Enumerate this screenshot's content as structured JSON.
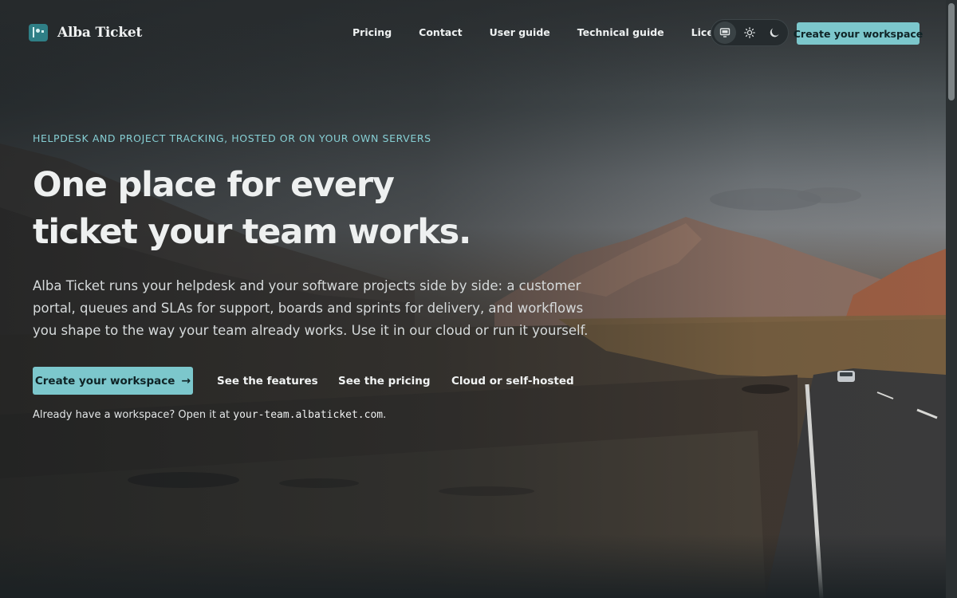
{
  "brand": {
    "name": "Alba Ticket"
  },
  "nav": {
    "items": [
      {
        "label": "Pricing"
      },
      {
        "label": "Contact"
      },
      {
        "label": "User guide"
      },
      {
        "label": "Technical guide"
      },
      {
        "label": "Licences"
      }
    ]
  },
  "theme_toggle": {
    "options": [
      {
        "icon": "monitor-icon",
        "active": true
      },
      {
        "icon": "sun-icon",
        "active": false
      },
      {
        "icon": "moon-icon",
        "active": false
      }
    ]
  },
  "header_cta": {
    "label": "Create your workspace"
  },
  "hero": {
    "eyebrow": "HELPDESK AND PROJECT TRACKING, HOSTED OR ON YOUR OWN SERVERS",
    "title_lines": [
      "One place for every",
      "ticket your team works."
    ],
    "description_lines": [
      "Alba Ticket runs your helpdesk and your software projects side by side: a customer",
      "portal, queues and SLAs for support, boards and sprints for delivery, and workflows",
      "you shape to the way your team already works. Use it in our cloud or run it yourself."
    ],
    "primary_cta": {
      "label": "Create your workspace",
      "icon": "arrow-right-icon",
      "glyph": "→"
    },
    "links": [
      {
        "label": "See the features"
      },
      {
        "label": "See the pricing"
      },
      {
        "label": "Cloud or self-hosted"
      }
    ],
    "signin_note": {
      "prefix": "Already have a workspace? Open it at ",
      "domain": "your-team.albaticket.com",
      "suffix": "."
    }
  },
  "colors": {
    "accent": "#7cc7cc",
    "eyebrow": "#86cfd4",
    "background": "#2a2e30"
  }
}
